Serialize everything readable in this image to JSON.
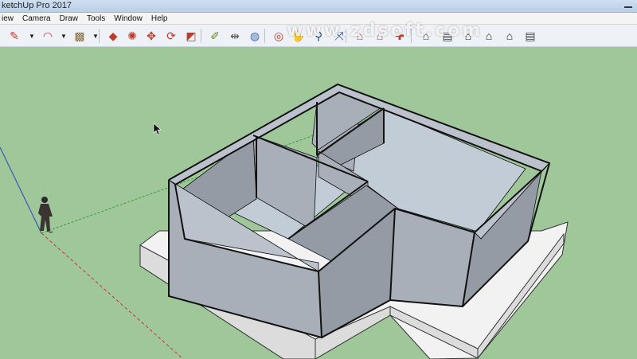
{
  "window": {
    "title": "ketchUp Pro 2017"
  },
  "menu": {
    "items": [
      "View",
      "Camera",
      "Draw",
      "Tools",
      "Window",
      "Help"
    ]
  },
  "menu_display": [
    "iew",
    "Camera",
    "Draw",
    "Tools",
    "Window",
    "Help"
  ],
  "watermark": "www.zdsoft.com",
  "toolbar": {
    "tools": [
      {
        "name": "line-tool",
        "icon": "pencil-icon",
        "glyph": "✎",
        "color": "#c0392b"
      },
      {
        "name": "arc-tool",
        "icon": "arc-icon",
        "glyph": "◠",
        "color": "#c0392b"
      },
      {
        "name": "shape-tool",
        "icon": "rectangle-icon",
        "glyph": "▩",
        "color": "#8a6a3a"
      },
      {
        "name": "push-pull-tool",
        "icon": "push-pull-icon",
        "glyph": "◆",
        "color": "#c0392b"
      },
      {
        "name": "follow-me-tool",
        "icon": "follow-me-icon",
        "glyph": "✺",
        "color": "#c0392b"
      },
      {
        "name": "move-tool",
        "icon": "move-icon",
        "glyph": "✥",
        "color": "#c0392b"
      },
      {
        "name": "rotate-tool",
        "icon": "rotate-icon",
        "glyph": "⟳",
        "color": "#c0392b"
      },
      {
        "name": "scale-tool",
        "icon": "scale-icon",
        "glyph": "◩",
        "color": "#c0392b"
      },
      {
        "name": "tape-measure-tool",
        "icon": "tape-measure-icon",
        "glyph": "✐",
        "color": "#6a8a2a"
      },
      {
        "name": "dimension-tool",
        "icon": "dimension-icon",
        "glyph": "⇹",
        "color": "#555555"
      },
      {
        "name": "paint-bucket-tool",
        "icon": "paint-bucket-icon",
        "glyph": "◍",
        "color": "#3a6ab0"
      },
      {
        "name": "orbit-tool",
        "icon": "orbit-icon",
        "glyph": "◎",
        "color": "#c0392b"
      },
      {
        "name": "pan-tool",
        "icon": "pan-icon",
        "glyph": "✋",
        "color": "#8a6a3a"
      },
      {
        "name": "zoom-tool",
        "icon": "zoom-icon",
        "glyph": "⚲",
        "color": "#2a4a80"
      },
      {
        "name": "zoom-extents-tool",
        "icon": "zoom-extents-icon",
        "glyph": "⤧",
        "color": "#2a4a80"
      },
      {
        "name": "warehouse-tool",
        "icon": "warehouse-icon",
        "glyph": "⌂",
        "color": "#c0392b"
      },
      {
        "name": "share-model-tool",
        "icon": "share-model-icon",
        "glyph": "⌂",
        "color": "#c0392b"
      },
      {
        "name": "extension-warehouse-tool",
        "icon": "extension-icon",
        "glyph": "✚",
        "color": "#c0392b"
      },
      {
        "name": "iso-view",
        "icon": "iso-view-icon",
        "glyph": "⌂",
        "color": "#444444"
      },
      {
        "name": "top-view",
        "icon": "top-view-icon",
        "glyph": "▤",
        "color": "#444444"
      },
      {
        "name": "front-view",
        "icon": "front-view-icon",
        "glyph": "⌂",
        "color": "#222222"
      },
      {
        "name": "right-view",
        "icon": "right-view-icon",
        "glyph": "⌂",
        "color": "#222222"
      },
      {
        "name": "back-view",
        "icon": "back-view-icon",
        "glyph": "⌂",
        "color": "#222222"
      },
      {
        "name": "left-view",
        "icon": "left-view-icon",
        "glyph": "▤",
        "color": "#444444"
      }
    ],
    "styles": [
      {
        "name": "xray-style",
        "icon": "xray-icon",
        "glyph": "◈",
        "color": "#555555"
      },
      {
        "name": "wireframe-style",
        "icon": "wireframe-icon",
        "glyph": "◇",
        "color": "#555555"
      },
      {
        "name": "hidden-line-style",
        "icon": "hidden-line-icon",
        "glyph": "◆",
        "color": "#777777"
      },
      {
        "name": "shaded-style",
        "icon": "shaded-icon",
        "glyph": "◼",
        "color": "#333333"
      },
      {
        "name": "shaded-textures-style",
        "icon": "shaded-textures-icon",
        "glyph": "◆",
        "color": "#3a7ab0"
      }
    ]
  },
  "scene": {
    "ground_color": "#9fc79a",
    "wall_color": "#a9afb8",
    "floor_color": "#c2ccd6",
    "base_color": "#f2f2f2",
    "edge_color": "#111111"
  }
}
